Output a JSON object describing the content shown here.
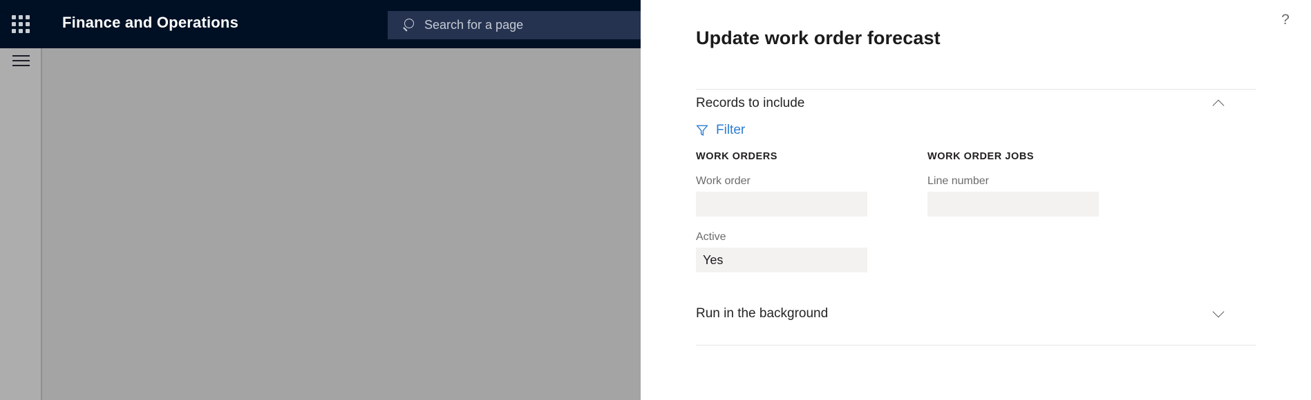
{
  "background_app": {
    "waffle_icon": "app-launcher-grid-icon",
    "title": "Finance and Operations",
    "search": {
      "icon": "search-icon",
      "placeholder": "Search for a page",
      "value": ""
    },
    "hamburger_icon": "hamburger-menu-icon"
  },
  "panel": {
    "title": "Update work order forecast",
    "help_icon": "?",
    "sections": [
      {
        "id": "records-to-include",
        "title": "Records to include",
        "expanded": true,
        "chevron": "chevron-up-icon"
      },
      {
        "id": "run-in-the-background",
        "title": "Run in the background",
        "expanded": false,
        "chevron": "chevron-down-icon"
      }
    ],
    "filter": {
      "icon": "filter-funnel-icon",
      "label": "Filter"
    },
    "columns": [
      {
        "id": "work-orders",
        "heading": "WORK ORDERS",
        "fields": [
          {
            "id": "work-order",
            "label": "Work order",
            "value": "",
            "placeholder": ""
          },
          {
            "id": "active",
            "label": "Active",
            "value": "Yes",
            "placeholder": ""
          }
        ]
      },
      {
        "id": "work-order-jobs",
        "heading": "WORK ORDER JOBS",
        "fields": [
          {
            "id": "line-number",
            "label": "Line number",
            "value": "",
            "placeholder": ""
          }
        ]
      }
    ]
  },
  "colors": {
    "navbar": "#001024",
    "search_field": "#253351",
    "panel_background": "#ffffff",
    "accent_link": "#2b7cd3",
    "input_background": "#f3f2f1",
    "canvas_overlay": "#a4a4a4",
    "rail_overlay": "#adadad",
    "divider": "#e6e6e6"
  }
}
